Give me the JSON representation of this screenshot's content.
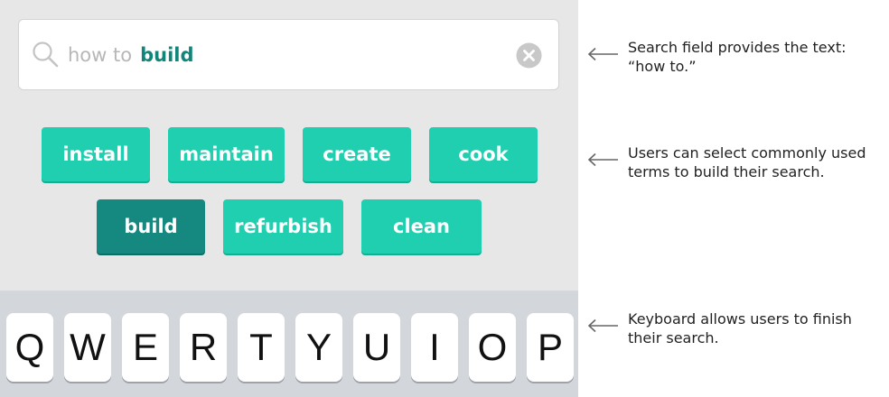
{
  "search": {
    "prefix": "how to",
    "term": "build"
  },
  "chips": [
    {
      "label": "install",
      "selected": false
    },
    {
      "label": "maintain",
      "selected": false
    },
    {
      "label": "create",
      "selected": false
    },
    {
      "label": "cook",
      "selected": false
    },
    {
      "label": "build",
      "selected": true
    },
    {
      "label": "refurbish",
      "selected": false
    },
    {
      "label": "clean",
      "selected": false
    }
  ],
  "keyboard": {
    "keys": [
      "Q",
      "W",
      "E",
      "R",
      "T",
      "Y",
      "U",
      "I",
      "O",
      "P"
    ]
  },
  "annotations": [
    {
      "text": "Search field provides the text: “how to.”"
    },
    {
      "text": "Users can select commonly used terms to build their search."
    },
    {
      "text": "Keyboard allows users to finish their search."
    }
  ],
  "colors": {
    "chip": "#20cfb0",
    "chip_selected": "#15897f",
    "search_term": "#12857b",
    "phone_background": "#e7e7e7",
    "keyboard_background": "#d3d7dc"
  }
}
